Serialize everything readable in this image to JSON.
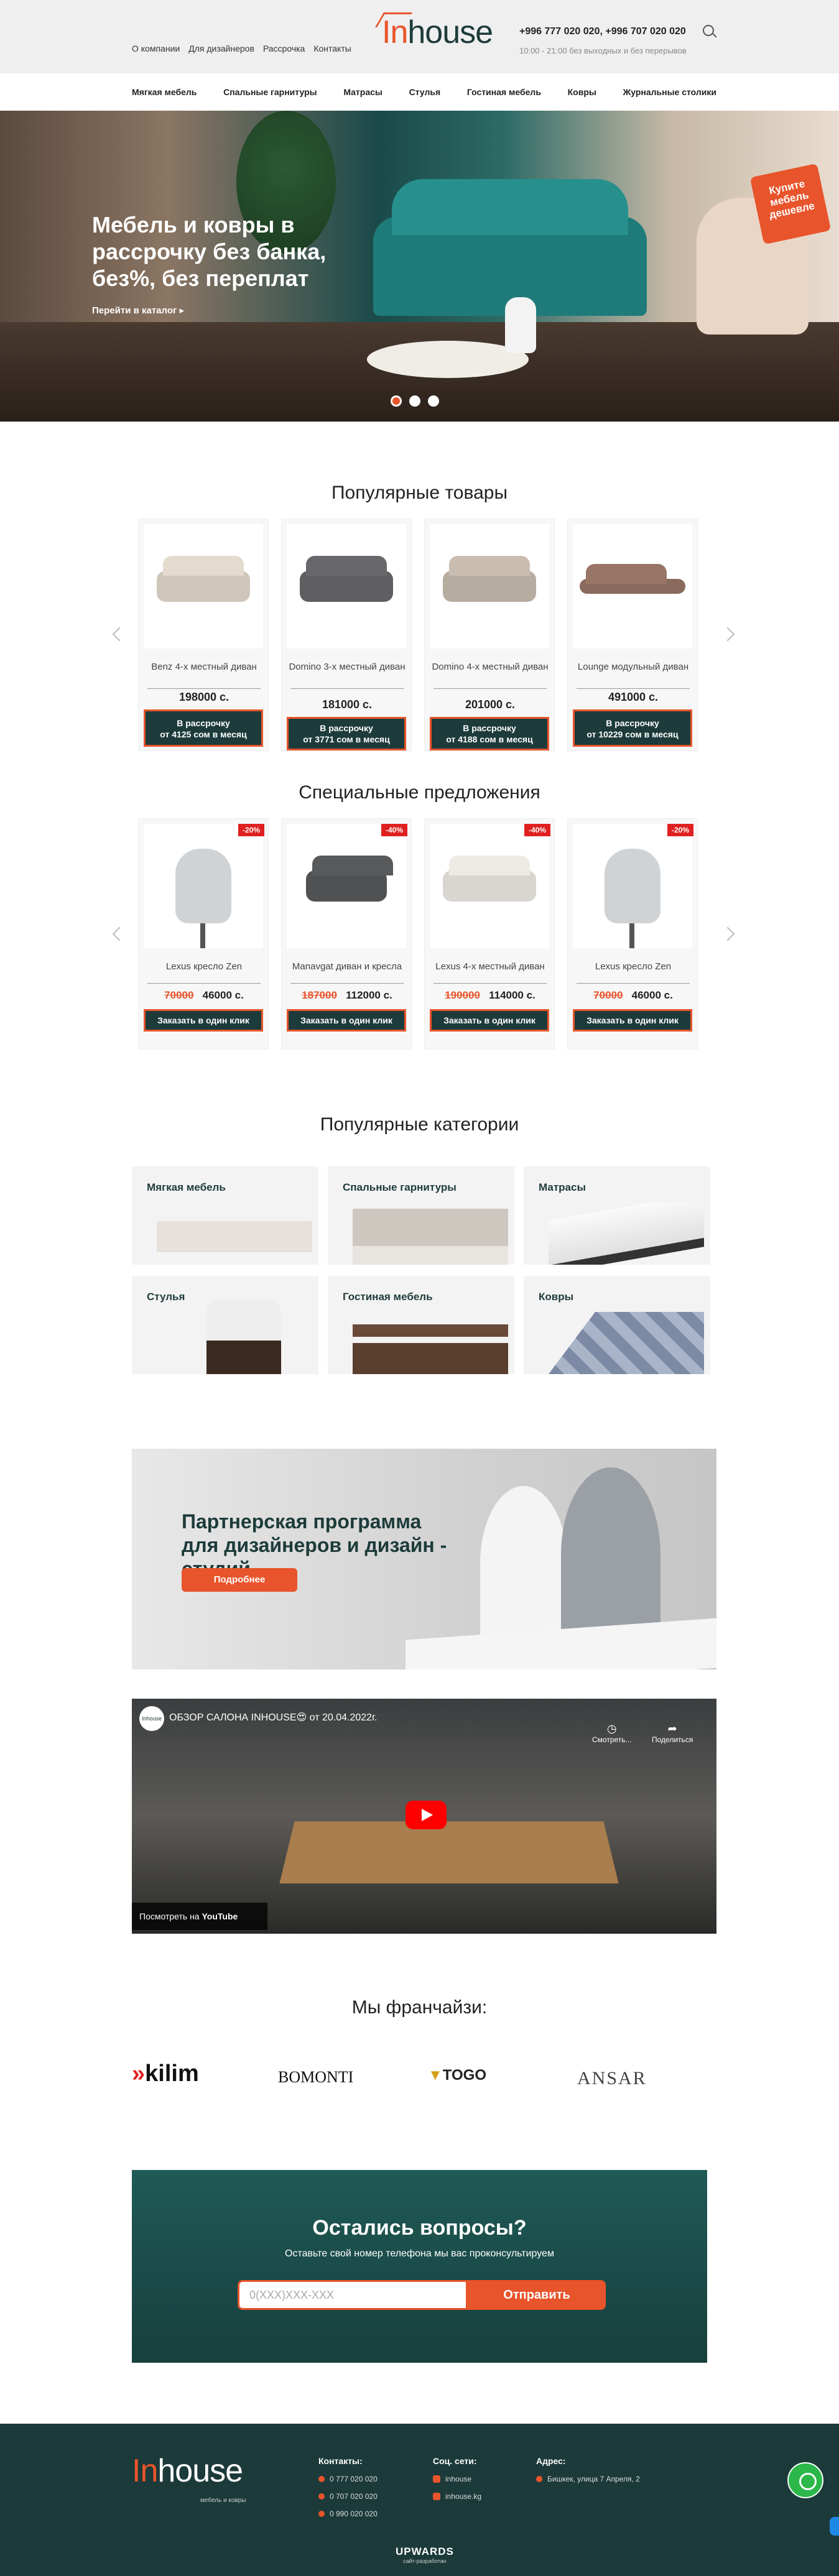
{
  "header": {
    "nav": [
      "О компании",
      "Для дизайнеров",
      "Рассрочка",
      "Контакты"
    ],
    "logo_in": "In",
    "logo_house": "house",
    "phones": "+996 777 020 020,   +996 707 020 020",
    "hours": "10:00 - 21:00 без выходных и без перерывов"
  },
  "catnav": [
    "Мягкая мебель",
    "Спальные гарнитуры",
    "Матрасы",
    "Стулья",
    "Гостиная мебель",
    "Ковры",
    "Журнальные столики"
  ],
  "hero": {
    "title": "Мебель и ковры в рассрочку без банка, без%, без переплат",
    "link": "Перейти в каталог",
    "badge": "Купите мебель дешевле"
  },
  "popular": {
    "title": "Популярные товары",
    "items": [
      {
        "name": "Benz 4-х местный диван",
        "price": "198000 с.",
        "btn1": "В рассрочку",
        "btn2": "от 4125 сом в месяц",
        "color": "#cfc6bb"
      },
      {
        "name": "Domino 3-х местный диван",
        "price": "181000 с.",
        "btn1": "В рассрочку",
        "btn2": "от 3771 сом в месяц",
        "color": "#5f5f62"
      },
      {
        "name": "Domino 4-х местный диван",
        "price": "201000 с.",
        "btn1": "В рассрочку",
        "btn2": "от 4188 сом в месяц",
        "color": "#b7aca0"
      },
      {
        "name": "Lounge модульный диван",
        "price": "491000 с.",
        "btn1": "В рассрочку",
        "btn2": "от 10229 сом в месяц",
        "color": "#8a6a5c"
      }
    ]
  },
  "special": {
    "title": "Специальные предложения",
    "items": [
      {
        "badge": "-20%",
        "name": "Lexus кресло Zen",
        "old": "70000",
        "price": "46000 с.",
        "btn": "Заказать в один клик"
      },
      {
        "badge": "-40%",
        "name": "Manavgat диван и кресла",
        "old": "187000",
        "price": "112000 с.",
        "btn": "Заказать в один клик"
      },
      {
        "badge": "-40%",
        "name": "Lexus 4-х местный диван",
        "old": "190000",
        "price": "114000 с.",
        "btn": "Заказать в один клик"
      },
      {
        "badge": "-20%",
        "name": "Lexus кресло Zen",
        "old": "70000",
        "price": "46000 с.",
        "btn": "Заказать в один клик"
      }
    ]
  },
  "categories": {
    "title": "Популярные категории",
    "items": [
      "Мягкая мебель",
      "Спальные гарнитуры",
      "Матрасы",
      "Стулья",
      "Гостиная мебель",
      "Ковры"
    ]
  },
  "partner": {
    "title": "Партнерская программа для дизайнеров и дизайн - студий",
    "btn": "Подробнее"
  },
  "video": {
    "channel": "Inhouse",
    "title": "ОБЗОР САЛОНА INHOUSE😍 от 20.04.2022г.",
    "watch_later": "Смотреть...",
    "share": "Поделиться",
    "watch_on": "Посмотреть на",
    "yt": "YouTube"
  },
  "franchise": {
    "title": "Мы франчайзи:",
    "brands": [
      "kilim",
      "BOMONTI",
      "TOGO",
      "ANSAR"
    ]
  },
  "questions": {
    "title": "Остались вопросы?",
    "sub": "Оставьте свой номер телефона мы вас проконсультируем",
    "placeholder": "0(XXX)XXX-XXX",
    "btn": "Отправить"
  },
  "footer": {
    "logo_sub": "мебель и ковры",
    "contacts_title": "Контакты:",
    "contacts": [
      "0 777 020 020",
      "0 707 020 020",
      "0 990 020 020"
    ],
    "social_title": "Соц. сети:",
    "social": [
      "inhouse",
      "inhouse.kg"
    ],
    "address_title": "Адрес:",
    "address": "Бишкек, улица 7 Апреля, 2",
    "dev": "UPWARDS",
    "dev_sub": "сайт-разработан"
  },
  "colors": {
    "accent": "#e8542b",
    "dark": "#1d3b3a"
  }
}
